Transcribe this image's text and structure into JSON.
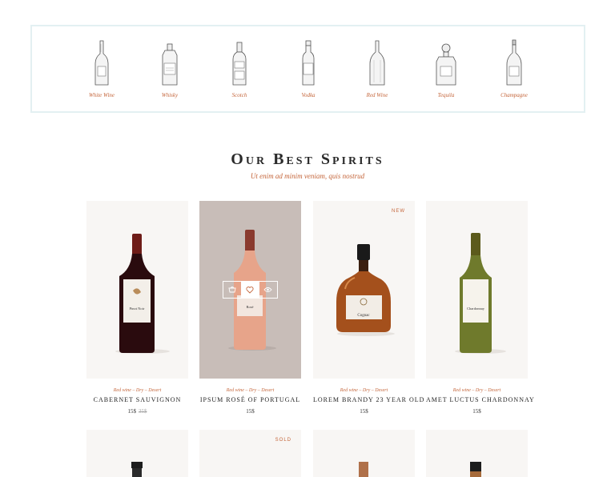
{
  "categories": [
    {
      "label": "White Wine",
      "icon": "wine-bottle-icon"
    },
    {
      "label": "Whisky",
      "icon": "whisky-bottle-icon"
    },
    {
      "label": "Scotch",
      "icon": "scotch-bottle-icon"
    },
    {
      "label": "Vodka",
      "icon": "vodka-bottle-icon"
    },
    {
      "label": "Red Wine",
      "icon": "red-wine-bottle-icon"
    },
    {
      "label": "Tequila",
      "icon": "tequila-bottle-icon"
    },
    {
      "label": "Champagne",
      "icon": "champagne-bottle-icon"
    }
  ],
  "section": {
    "title": "Our Best Spirits",
    "subtitle": "Ut enim ad minim veniam, quis nostrud"
  },
  "products": [
    {
      "category": "Red wine – Dry – Desert",
      "name": "Cabernet Sauvignon",
      "price": "15$",
      "old_price": "35$",
      "badge": "",
      "bottle_label": "Pinot Noir"
    },
    {
      "category": "Red wine – Dry – Desert",
      "name": "Ipsum Rosé of Portugal",
      "price": "15$",
      "old_price": "",
      "badge": "",
      "bottle_label": "Rosé"
    },
    {
      "category": "Red wine – Dry – Desert",
      "name": "Lorem Brandy 23 Year Old",
      "price": "15$",
      "old_price": "",
      "badge": "New",
      "bottle_label": "Cognac"
    },
    {
      "category": "Red wine – Dry – Desert",
      "name": "Amet Luctus Chardonnay",
      "price": "15$",
      "old_price": "",
      "badge": "",
      "bottle_label": "Chardonnay"
    }
  ],
  "second_row": [
    {
      "badge": ""
    },
    {
      "badge": "Sold"
    },
    {
      "badge": ""
    },
    {
      "badge": ""
    }
  ],
  "actions": [
    {
      "icon": "cart-icon"
    },
    {
      "icon": "heart-icon"
    },
    {
      "icon": "eye-icon"
    }
  ],
  "colors": {
    "accent": "#c4653a",
    "card_bg": "#f8f6f4",
    "hover_bg": "#c8bdb8",
    "strip_border": "#e3f0f2"
  }
}
